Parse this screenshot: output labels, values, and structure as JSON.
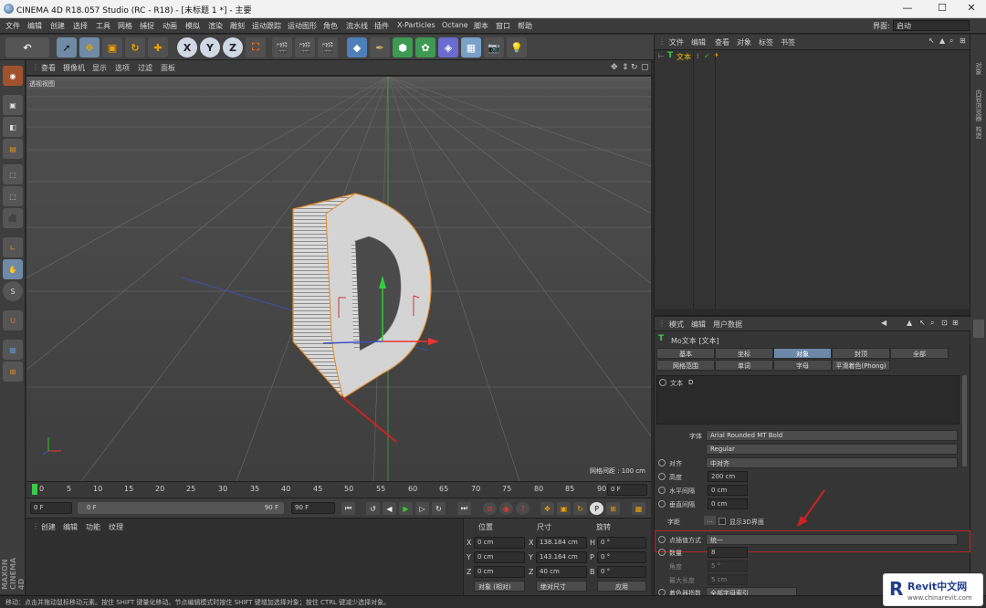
{
  "window": {
    "title": "CINEMA 4D R18.057 Studio (RC - R18) - [未标题 1 *] - 主要"
  },
  "menu": {
    "items": [
      "文件",
      "编辑",
      "创建",
      "选择",
      "工具",
      "网格",
      "捕捉",
      "动画",
      "模拟",
      "渲染",
      "雕刻",
      "运动跟踪",
      "运动图形",
      "角色",
      "流水线",
      "插件",
      "X-Particles",
      "Octane",
      "脚本",
      "窗口",
      "帮助"
    ],
    "layout_label": "界面:",
    "layout_value": "启动"
  },
  "toolbar": {
    "axis_x": "X",
    "axis_y": "Y",
    "axis_z": "Z"
  },
  "viewport": {
    "menu": [
      "查看",
      "摄像机",
      "显示",
      "选项",
      "过滤",
      "面板"
    ],
    "label": "透视视图",
    "grid_spacing": "网格间距 : 100 cm",
    "letter": "D"
  },
  "timeline": {
    "ticks": [
      "0",
      "5",
      "10",
      "15",
      "20",
      "25",
      "30",
      "35",
      "40",
      "45",
      "50",
      "55",
      "60",
      "65",
      "70",
      "75",
      "80",
      "85",
      "90"
    ],
    "current": "0 F"
  },
  "transport": {
    "start": "0 F",
    "range_start": "0 F",
    "range_end": "90 F",
    "end": "90 F"
  },
  "material": {
    "menu": [
      "创建",
      "编辑",
      "功能",
      "纹理"
    ]
  },
  "coords": {
    "headers": [
      "位置",
      "尺寸",
      "旋转"
    ],
    "rows": [
      {
        "axis": "X",
        "pos": "0 cm",
        "size_axis": "X",
        "size": "138.184 cm",
        "rot_axis": "H",
        "rot": "0 °"
      },
      {
        "axis": "Y",
        "pos": "0 cm",
        "size_axis": "Y",
        "size": "143.164 cm",
        "rot_axis": "P",
        "rot": "0 °"
      },
      {
        "axis": "Z",
        "pos": "0 cm",
        "size_axis": "Z",
        "size": "40 cm",
        "rot_axis": "B",
        "rot": "0 °"
      }
    ],
    "mode": "对象 (相对)",
    "size_mode": "绝对尺寸",
    "apply": "应用"
  },
  "objects": {
    "menu": [
      "文件",
      "编辑",
      "查看",
      "对象",
      "标签",
      "书签"
    ],
    "item": "文本"
  },
  "side_tabs": [
    "对象",
    "内容浏览器",
    "构造"
  ],
  "attributes": {
    "menu": [
      "模式",
      "编辑",
      "用户数据"
    ],
    "object_title": "Mo文本 [文本]",
    "tabs_row1": [
      "基本",
      "坐标",
      "对象",
      "封顶",
      "全部"
    ],
    "tabs_row2": [
      "网格范围",
      "单词",
      "字母",
      "平滑着色(Phong)"
    ],
    "active_tab": "对象",
    "text_label": "文本",
    "text_value": "D",
    "font_label": "字体",
    "font_value": "Arial Rounded MT Bold",
    "font_style": "Regular",
    "align_label": "对齐",
    "align_value": "中对齐",
    "height_label": "高度",
    "height_value": "200 cm",
    "hspace_label": "水平间隔",
    "hspace_value": "0 cm",
    "vspace_label": "垂直间隔",
    "vspace_value": "0 cm",
    "kerning_label": "字距",
    "show3d_label": "显示3D界面",
    "interp_label": "点插值方式",
    "interp_value": "统一",
    "count_label": "数量",
    "count_value": "8",
    "angle_label": "角度",
    "angle_value": "5 °",
    "maxlen_label": "最大长度",
    "maxlen_value": "5 cm",
    "shader_label": "着色器指数",
    "shader_value": "全部字母索引"
  },
  "status": {
    "text": "移动：点击并拖动鼠标移动元素。按住 SHIFT 键量化移动。节点编辑模式时按住 SHIFT 键增加选择对象；按住 CTRL 键减少选择对象。"
  },
  "watermark": {
    "brand": "Revit中文网",
    "url": "www.chinarevit.com"
  },
  "brand_vertical": "MAXON CINEMA 4D"
}
